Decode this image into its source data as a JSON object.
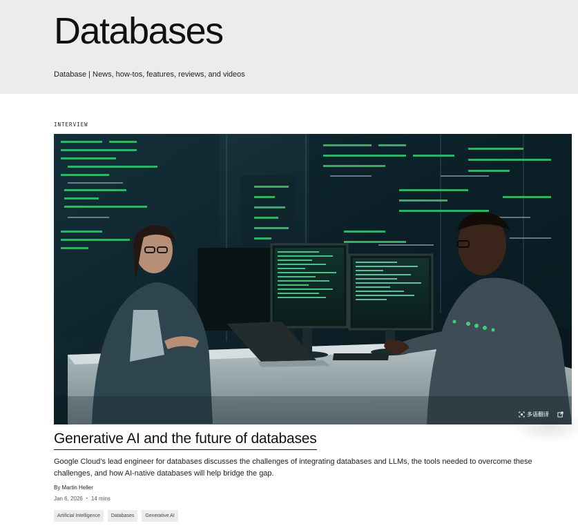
{
  "header": {
    "title": "Databases",
    "subtitle": "Database | News, how-tos, features, reviews, and videos"
  },
  "article": {
    "kicker": "INTERVIEW",
    "image_tools": {
      "translate_label": "多语翻译"
    },
    "headline": "Generative AI and the future of databases",
    "dek": "Google Cloud’s lead engineer for databases discusses the challenges of integrating databases and LLMs, the tools needed to overcome these challenges, and how AI-native databases will help bridge the gap.",
    "byline": "By Martin Heller",
    "date": "Jan 6, 2026",
    "separator": "•",
    "read_time": "14 mins",
    "tags": [
      "Artificial Intelligence",
      "Databases",
      "Generative AI"
    ]
  },
  "colors": {
    "header_band": "#ececec",
    "code_green": "#3fe07a",
    "image_dark": "#0b1a22"
  },
  "icons": [
    "scan-icon",
    "external-link-icon"
  ]
}
